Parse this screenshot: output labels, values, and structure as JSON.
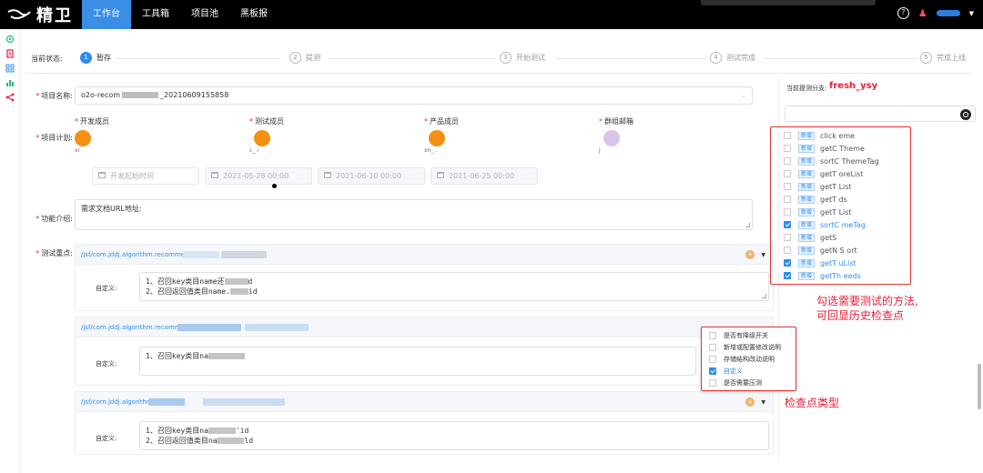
{
  "header": {
    "app_title": "精卫",
    "nav": [
      {
        "label": "工作台",
        "active": true
      },
      {
        "label": "工具箱",
        "active": false
      },
      {
        "label": "项目池",
        "active": false
      },
      {
        "label": "黑板报",
        "active": false
      }
    ],
    "help_glyph": "?"
  },
  "steps": {
    "label": "当前状态:",
    "items": [
      {
        "num": "1",
        "label": "暂存",
        "active": true
      },
      {
        "num": "2",
        "label": "提测",
        "active": false
      },
      {
        "num": "3",
        "label": "开始测试",
        "active": false
      },
      {
        "num": "4",
        "label": "测试完成",
        "active": false
      },
      {
        "num": "5",
        "label": "完成上线",
        "active": false
      }
    ]
  },
  "form": {
    "project_name_label": "项目名称:",
    "project_name_value_start": "o2o-recom",
    "project_name_value_end": "_20210609155858",
    "project_plan_label": "项目计划:",
    "members": [
      {
        "title": "开发成员",
        "name": "xi",
        "color": "#f59012"
      },
      {
        "title": "测试成员",
        "name": "c_   i",
        "color": "#f59012"
      },
      {
        "title": "产品成员",
        "name": "xn_ .",
        "color": "#f59012"
      },
      {
        "title": "群组邮箱",
        "name": "j",
        "color": "#d9c4ea"
      }
    ],
    "dates": {
      "dev_start_placeholder": "开发起始时间",
      "d1": "2021-05-28 00:00",
      "d2": "2021-06-10 00:00",
      "d3": "2021-06-25 00:00"
    },
    "feature_label": "功能介绍:",
    "feature_value": "需求文档URL地址:",
    "test_focus_label": "测试重点:"
  },
  "panels": [
    {
      "path": "/jsf/com.jddj.algorithm.recomme",
      "custom_label": "自定义:",
      "lines": [
        "1、召回key类目name还",
        "2、召回返回值类目name."
      ],
      "line_tails": [
        "d",
        "id"
      ]
    },
    {
      "path": "/jsf/com.jddj.algorithm.recommer",
      "custom_label": "自定义:",
      "lines": [
        "1、召回key类目na"
      ],
      "line_tails": [
        ""
      ]
    },
    {
      "path": "/jsf/com.jddj.algorithm",
      "custom_label": "自定义:",
      "lines": [
        "1、召回key类目na",
        "2、召回返回值类目na"
      ],
      "line_tails": [
        "'id",
        "ld"
      ]
    }
  ],
  "branch": {
    "label": "当前提测分支:",
    "name": "fresh_ysy",
    "methods": [
      {
        "tag": "新增",
        "name": "click   eme",
        "checked": false
      },
      {
        "tag": "新增",
        "name": "getC       Theme",
        "checked": false
      },
      {
        "tag": "新增",
        "name": "sortC        ThemeTag",
        "checked": false
      },
      {
        "tag": "新增",
        "name": "getT       oreList",
        "checked": false
      },
      {
        "tag": "新增",
        "name": "getT        List",
        "checked": false
      },
      {
        "tag": "新增",
        "name": "getT       ds",
        "checked": false
      },
      {
        "tag": "新增",
        "name": "getT        List",
        "checked": false
      },
      {
        "tag": "新增",
        "name": "sortC        meTag",
        "checked": true
      },
      {
        "tag": "新增",
        "name": "getS",
        "checked": false
      },
      {
        "tag": "新增",
        "name": "getN       S   ort",
        "checked": false
      },
      {
        "tag": "新增",
        "name": "getT      uList",
        "checked": true
      },
      {
        "tag": "新增",
        "name": "getTh      eeds",
        "checked": true
      }
    ],
    "annotation_line1": "勾选需要测试的方法,",
    "annotation_line2": "可回显历史检查点"
  },
  "checkpoints": {
    "items": [
      {
        "label": "是否有降级开关",
        "checked": false
      },
      {
        "label": "新增或配置修改说明",
        "checked": false
      },
      {
        "label": "存储结构改动说明",
        "checked": false
      },
      {
        "label": "自定义",
        "checked": true
      },
      {
        "label": "是否需要压测",
        "checked": false
      }
    ],
    "annotation": "检查点类型"
  },
  "colors": {
    "accent": "#2d8cf0",
    "annotation_red": "#e6213a",
    "header_bg": "#000000"
  }
}
